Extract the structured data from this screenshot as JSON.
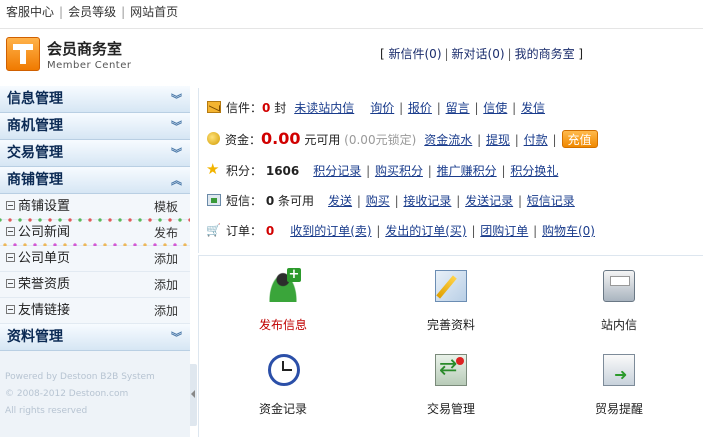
{
  "topbar": {
    "links": [
      "客服中心",
      "会员等级",
      "网站首页"
    ]
  },
  "header": {
    "logo_title": "会员商务室",
    "logo_subtitle": "Member Center",
    "links": {
      "new_mail": "新信件(0)",
      "new_chat": "新对话(0)",
      "my_office": "我的商务室"
    }
  },
  "sidebar": {
    "sections": [
      {
        "label": "信息管理"
      },
      {
        "label": "商机管理"
      },
      {
        "label": "交易管理"
      },
      {
        "label": "商铺管理"
      }
    ],
    "items": [
      {
        "label": "商铺设置",
        "action": "模板"
      },
      {
        "label": "公司新闻",
        "action": "发布"
      },
      {
        "label": "公司单页",
        "action": "添加"
      },
      {
        "label": "荣誉资质",
        "action": "添加"
      },
      {
        "label": "友情链接",
        "action": "添加"
      }
    ],
    "last_section": "资料管理",
    "copyright": {
      "line1": "Powered by Destoon B2B System",
      "line2": "© 2008-2012 Destoon.com",
      "line3": "All rights reserved"
    }
  },
  "info": {
    "mail": {
      "label": "信件：",
      "count": "0",
      "unit": "封",
      "links": [
        "未读站内信",
        "询价",
        "报价",
        "留言",
        "信使",
        "发信"
      ]
    },
    "funds": {
      "label": "资金：",
      "amount": "0.00",
      "unit": "元可用",
      "locked": "(0.00元锁定)",
      "links": [
        "资金流水",
        "提现",
        "付款"
      ],
      "recharge": "充值"
    },
    "points": {
      "label": "积分：",
      "amount": "1606",
      "links": [
        "积分记录",
        "购买积分",
        "推广赚积分",
        "积分换礼"
      ]
    },
    "sms": {
      "label": "短信：",
      "amount": "0",
      "unit": "条可用",
      "links": [
        "发送",
        "购买",
        "接收记录",
        "发送记录",
        "短信记录"
      ]
    },
    "orders": {
      "label": "订单：",
      "count": "0",
      "links": [
        "收到的订单(卖)",
        "发出的订单(买)",
        "团购订单",
        "购物车(0)"
      ]
    }
  },
  "grid": [
    {
      "label": "发布信息",
      "icon": "publish-user-icon",
      "highlight": true
    },
    {
      "label": "完善资料",
      "icon": "edit-profile-icon",
      "highlight": false
    },
    {
      "label": "站内信",
      "icon": "inbox-icon",
      "highlight": false
    },
    {
      "label": "资金记录",
      "icon": "clock-icon",
      "highlight": false
    },
    {
      "label": "交易管理",
      "icon": "trade-icon",
      "highlight": false
    },
    {
      "label": "贸易提醒",
      "icon": "remind-icon",
      "highlight": false
    }
  ]
}
